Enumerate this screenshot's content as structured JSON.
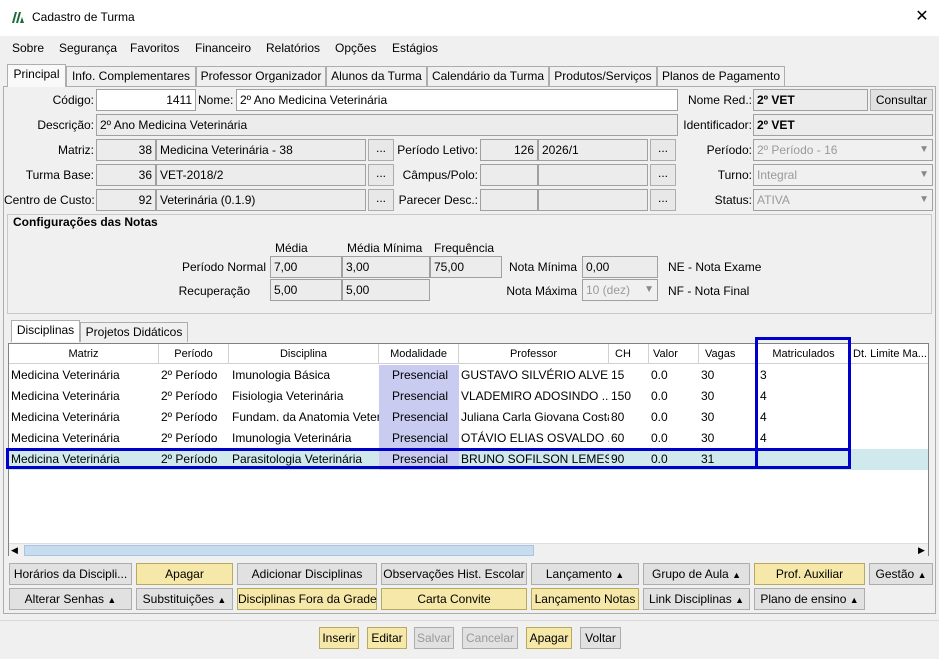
{
  "window": {
    "title": "Cadastro de Turma"
  },
  "menu": [
    "Sobre",
    "Segurança",
    "Favoritos",
    "Financeiro",
    "Relatórios",
    "Opções",
    "Estágios"
  ],
  "tabs": [
    "Principal",
    "Info. Complementares",
    "Professor Organizador",
    "Alunos da Turma",
    "Calendário da Turma",
    "Produtos/Serviços",
    "Planos de Pagamento"
  ],
  "form": {
    "codigo_label": "Código:",
    "codigo": "1411",
    "nome_label": "Nome:",
    "nome": "2º Ano Medicina Veterinária",
    "nome_red_label": "Nome Red.:",
    "nome_red": "2º VET",
    "consultar": "Consultar",
    "descricao_label": "Descrição:",
    "descricao": "2º Ano Medicina Veterinária",
    "identificador_label": "Identificador:",
    "identificador": "2º VET",
    "matriz_label": "Matriz:",
    "matriz_id": "38",
    "matriz": "Medicina Veterinária - 38",
    "periodo_letivo_label": "Período Letivo:",
    "periodo_letivo_id": "126",
    "periodo_letivo": "2026/1",
    "periodo_label": "Período:",
    "periodo": "2º Período - 16",
    "turma_base_label": "Turma Base:",
    "turma_base_id": "36",
    "turma_base": "VET-2018/2",
    "campus_label": "Câmpus/Polo:",
    "turno_label": "Turno:",
    "turno": "Integral",
    "centro_custo_label": "Centro de Custo:",
    "centro_custo_id": "92",
    "centro_custo": "Veterinária (0.1.9)",
    "parecer_label": "Parecer Desc.:",
    "status_label": "Status:",
    "status": "ATIVA",
    "dots": "..."
  },
  "notas": {
    "title": "Configurações das Notas",
    "col_media": "Média",
    "col_media_min": "Média Mínima",
    "col_freq": "Frequência",
    "periodo_normal_label": "Período Normal",
    "pn_media": "7,00",
    "pn_media_min": "3,00",
    "pn_freq": "75,00",
    "recuperacao_label": "Recuperação",
    "rec_media": "5,00",
    "rec_media_min": "5,00",
    "nota_minima_label": "Nota Mínima",
    "nota_minima": "0,00",
    "nota_maxima_label": "Nota Máxima",
    "nota_maxima": "10 (dez)",
    "ne_label": "NE - Nota Exame",
    "nf_label": "NF - Nota Final"
  },
  "subtabs": [
    "Disciplinas",
    "Projetos Didáticos"
  ],
  "grid": {
    "headers": [
      "Matriz",
      "Período",
      "Disciplina",
      "Modalidade",
      "Professor",
      "CH",
      "Valor",
      "Vagas",
      "Matriculados",
      "Dt. Limite Ma..."
    ],
    "rows": [
      [
        "Medicina Veterinária",
        "2º Período",
        "Imunologia Básica",
        "Presencial",
        "GUSTAVO SILVÉRIO ALVES",
        "15",
        "0.0",
        "30",
        "3"
      ],
      [
        "Medicina Veterinária",
        "2º Período",
        "Fisiologia Veterinária",
        "Presencial",
        "VLADEMIRO ADOSINDO ...",
        "150",
        "0.0",
        "30",
        "4"
      ],
      [
        "Medicina Veterinária",
        "2º Período",
        "Fundam. da Anatomia Veter",
        "Presencial",
        "Juliana Carla Giovana Costa",
        "80",
        "0.0",
        "30",
        "4"
      ],
      [
        "Medicina Veterinária",
        "2º Período",
        "Imunologia Veterinária",
        "Presencial",
        "OTÁVIO ELIAS OSVALDO ...",
        "60",
        "0.0",
        "30",
        "4"
      ],
      [
        "Medicina Veterinária",
        "2º Período",
        "Parasitologia Veterinária",
        "Presencial",
        "BRUNO SOFILSON LEMES",
        "90",
        "0.0",
        "31",
        ""
      ]
    ]
  },
  "actions_row1": [
    "Horários da Discipli...",
    "Apagar",
    "Adicionar Disciplinas",
    "Observações Hist. Escolar",
    "Lançamento",
    "Grupo de Aula",
    "Prof. Auxiliar",
    "Gestão"
  ],
  "actions_row2": [
    "Alterar Senhas",
    "Substituições",
    "Disciplinas Fora da Grade",
    "Carta Convite",
    "Lançamento Notas",
    "Link Disciplinas",
    "Plano de ensino"
  ],
  "bottom": [
    "Inserir",
    "Editar",
    "Salvar",
    "Cancelar",
    "Apagar",
    "Voltar"
  ]
}
